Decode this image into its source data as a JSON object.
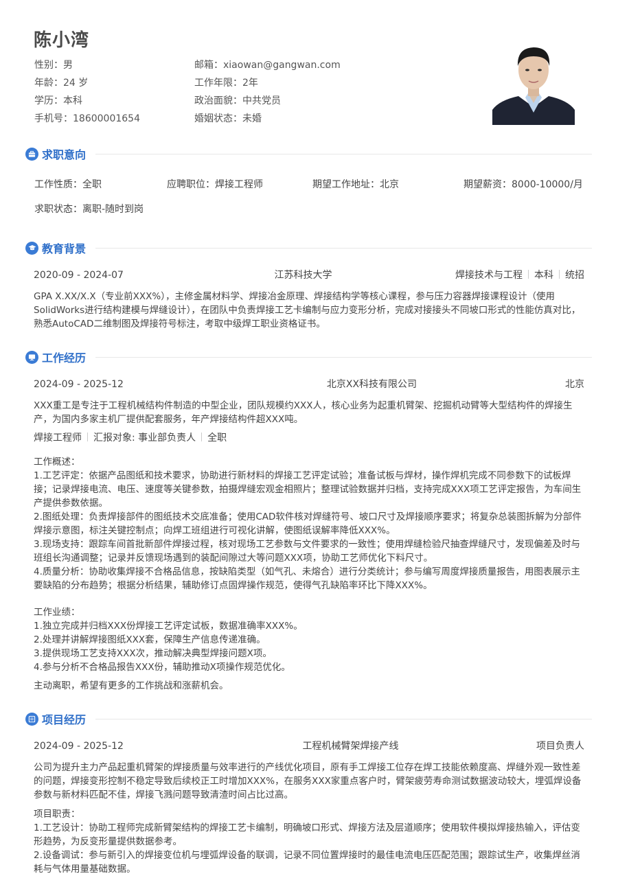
{
  "profile": {
    "name": "陈小湾",
    "gender_label": "性别：",
    "gender": "男",
    "age_label": "年龄：",
    "age": "24 岁",
    "edu_label": "学历：",
    "edu": "本科",
    "phone_label": "手机号：",
    "phone": "18600001654",
    "email_label": "邮箱：",
    "email": "xiaowan@gangwan.com",
    "years_label": "工作年限：",
    "years": "2年",
    "politics_label": "政治面貌：",
    "politics": "中共党员",
    "marital_label": "婚姻状态：",
    "marital": "未婚"
  },
  "intent": {
    "title": "求职意向",
    "type_label": "工作性质：",
    "type": "全职",
    "position_label": "应聘职位：",
    "position": "焊接工程师",
    "city_label": "期望工作地址：",
    "city": "北京",
    "salary_label": "期望薪资：",
    "salary": "8000-10000/月",
    "status_label": "求职状态：",
    "status": "离职-随时到岗"
  },
  "education": {
    "title": "教育背景",
    "period": "2020-09 - 2024-07",
    "school": "江苏科技大学",
    "major": "焊接技术与工程",
    "degree": "本科",
    "admission": "统招",
    "desc": "GPA X.XX/X.X（专业前XXX%），主修金属材料学、焊接冶金原理、焊接结构学等核心课程，参与压力容器焊接课程设计（使用SolidWorks进行结构建模与焊缝设计），在团队中负责焊接工艺卡编制与应力变形分析，完成对接接头不同坡口形式的性能仿真对比，熟悉AutoCAD二维制图及焊接符号标注，考取中级焊工职业资格证书。"
  },
  "work": {
    "title": "工作经历",
    "period": "2024-09 - 2025-12",
    "company": "北京XX科技有限公司",
    "city": "北京",
    "company_desc": "XXX重工是专注于工程机械结构件制造的中型企业，团队规模约XXX人，核心业务为起重机臂架、挖掘机动臂等大型结构件的焊接生产，为国内多家主机厂提供配套服务，年产焊接结构件超XXX吨。",
    "role": "焊接工程师",
    "report": "汇报对象: 事业部负责人",
    "job_type": "全职",
    "overview_title": "工作概述：",
    "overview": [
      "1.工艺评定：依据产品图纸和技术要求，协助进行新材料的焊接工艺评定试验；准备试板与焊材，操作焊机完成不同参数下的试板焊接；记录焊接电流、电压、速度等关键参数，拍摄焊缝宏观金相照片；整理试验数据并归档，支持完成XXX项工艺评定报告，为车间生产提供参数依据。",
      "2.图纸处理：负责焊接部件的图纸技术交底准备；使用CAD软件核对焊缝符号、坡口尺寸及焊接顺序要求；将复杂总装图拆解为分部件焊接示意图，标注关键控制点；向焊工班组进行可视化讲解，使图纸误解率降低XXX%。",
      "3.现场支持：跟踪车间首批新部件焊接过程，核对现场工艺参数与文件要求的一致性；使用焊缝检验尺抽查焊缝尺寸，发现偏差及时与班组长沟通调整；记录并反馈现场遇到的装配间隙过大等问题XXX项，协助工艺师优化下料尺寸。",
      "4.质量分析：协助收集焊接不合格品信息，按缺陷类型（如气孔、未熔合）进行分类统计；参与编写周度焊接质量报告，用图表展示主要缺陷的分布趋势；根据分析结果，辅助修订点固焊操作规范，使得气孔缺陷率环比下降XXX%。"
    ],
    "achieve_title": "工作业绩：",
    "achievements": [
      "1.独立完成并归档XXX份焊接工艺评定试板，数据准确率XXX%。",
      "2.处理并讲解焊接图纸XXX套，保障生产信息传递准确。",
      "3.提供现场工艺支持XXX次，推动解决典型焊接问题X项。",
      "4.参与分析不合格品报告XXX份，辅助推动X项操作规范优化。"
    ],
    "leave_reason": "主动离职，希望有更多的工作挑战和涨薪机会。"
  },
  "project": {
    "title": "项目经历",
    "period": "2024-09 - 2025-12",
    "name": "工程机械臂架焊接产线",
    "role": "项目负责人",
    "desc": "公司为提升主力产品起重机臂架的焊接质量与效率进行的产线优化项目，原有手工焊接工位存在焊工技能依赖度高、焊缝外观一致性差的问题，焊接变形控制不稳定导致后续校正工时增加XXX%，在服务XXX家重点客户时，臂架疲劳寿命测试数据波动较大，埋弧焊设备参数与新材料匹配不佳，焊接飞溅问题导致清渣时间占比过高。",
    "duty_title": "项目职责：",
    "duties": [
      "1.工艺设计：协助工程师完成新臂架结构的焊接工艺卡编制，明确坡口形式、焊接方法及层道顺序；使用软件模拟焊接热输入，评估变形趋势，为反变形量提供数据参考。",
      "2.设备调试：参与新引入的焊接变位机与埋弧焊设备的联调，记录不同位置焊接时的最佳电流电压匹配范围；跟踪试生产，收集焊丝消耗与气体用量基础数据。"
    ]
  }
}
